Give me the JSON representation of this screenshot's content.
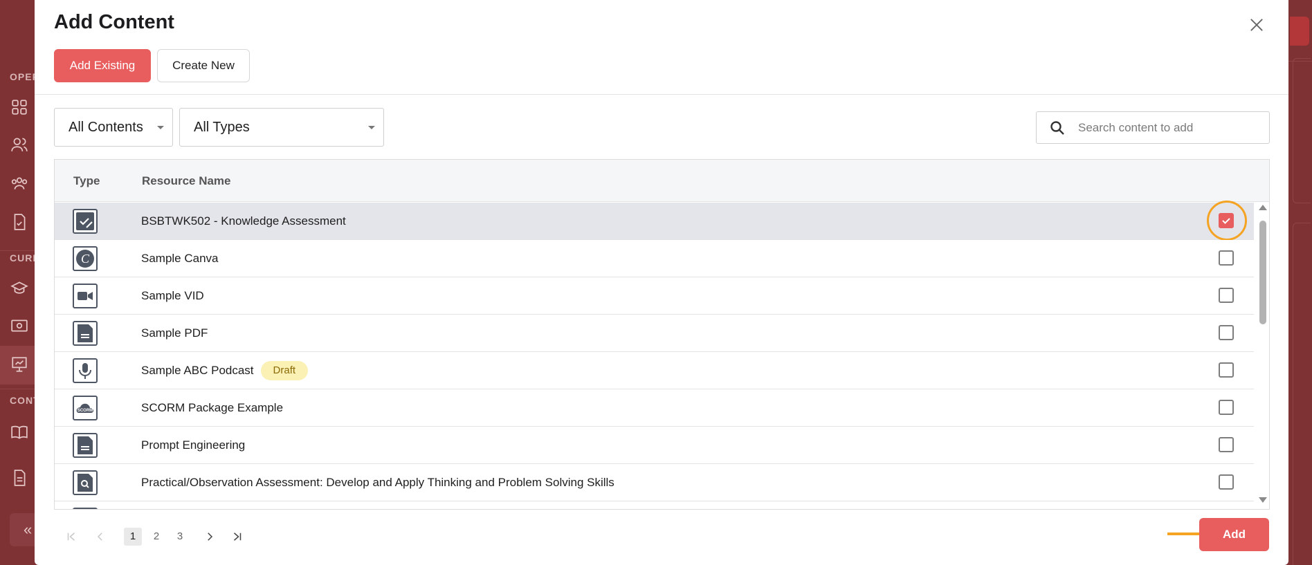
{
  "background": {
    "sidebar_sections": [
      "OPER",
      "CURR",
      "CONT"
    ],
    "collapse_glyph": "«"
  },
  "modal": {
    "title": "Add Content",
    "close_icon": "close-icon",
    "tabs": [
      {
        "label": "Add Existing",
        "active": true
      },
      {
        "label": "Create New",
        "active": false
      }
    ]
  },
  "filters": {
    "contents": "All Contents",
    "types": "All Types"
  },
  "search": {
    "placeholder": "Search content to add"
  },
  "table": {
    "headers": {
      "type": "Type",
      "name": "Resource Name"
    },
    "rows": [
      {
        "icon": "assessment-icon",
        "name": "BSBTWK502 - Knowledge Assessment",
        "badge": "",
        "checked": true
      },
      {
        "icon": "canva-icon",
        "name": "Sample Canva",
        "badge": "",
        "checked": false
      },
      {
        "icon": "video-icon",
        "name": "Sample VID",
        "badge": "",
        "checked": false
      },
      {
        "icon": "document-icon",
        "name": "Sample PDF",
        "badge": "",
        "checked": false
      },
      {
        "icon": "microphone-icon",
        "name": "Sample ABC Podcast",
        "badge": "Draft",
        "checked": false
      },
      {
        "icon": "scorm-icon",
        "name": "SCORM Package Example",
        "badge": "",
        "checked": false
      },
      {
        "icon": "document-icon",
        "name": "Prompt Engineering",
        "badge": "",
        "checked": false
      },
      {
        "icon": "observation-icon",
        "name": "Practical/Observation Assessment: Develop and Apply Thinking and Problem Solving Skills",
        "badge": "",
        "checked": false
      }
    ]
  },
  "pagination": {
    "pages": [
      "1",
      "2",
      "3"
    ],
    "current": "1"
  },
  "actions": {
    "add_label": "Add"
  },
  "colors": {
    "accent": "#e85d5e",
    "highlight": "#f4a322",
    "draft_badge": "#fbf1b5"
  }
}
